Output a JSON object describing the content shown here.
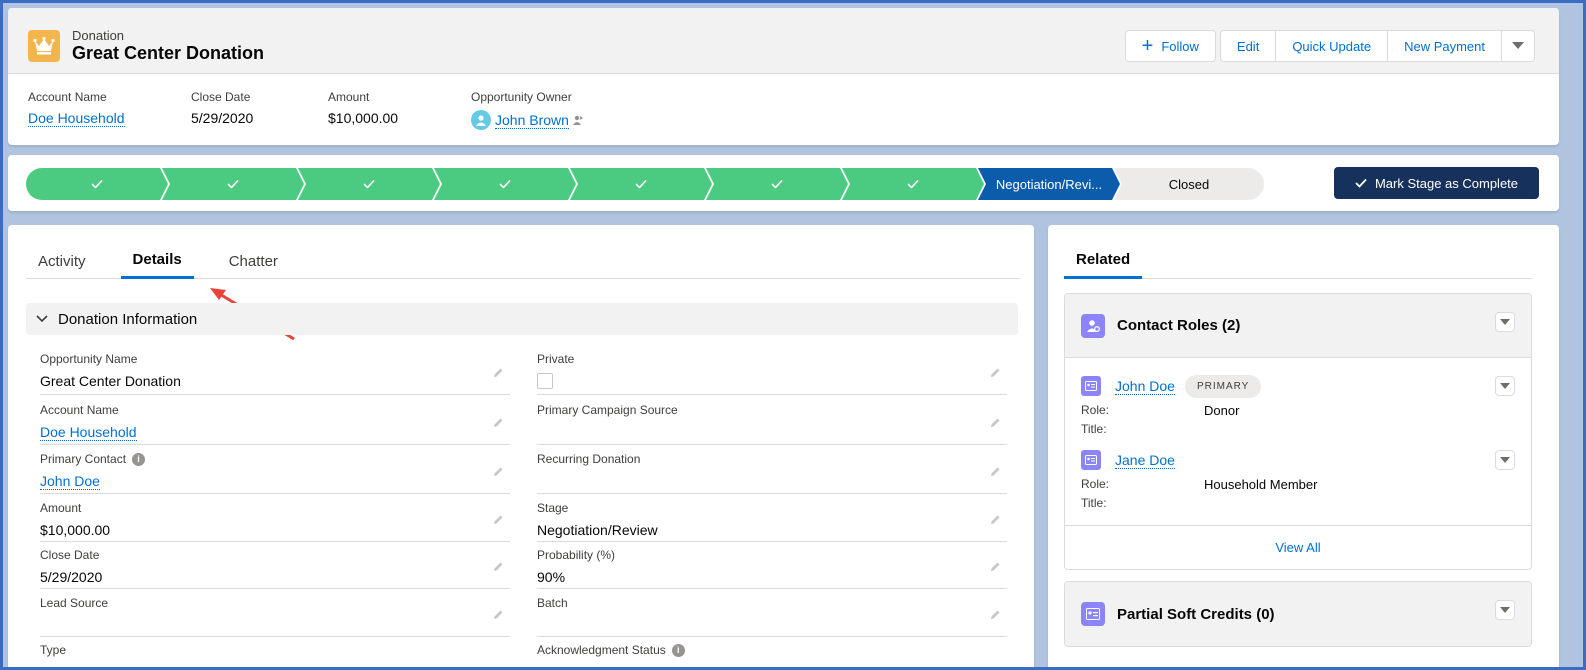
{
  "header": {
    "object_type": "Donation",
    "record_title": "Great Center Donation",
    "buttons": {
      "follow": "Follow",
      "edit": "Edit",
      "quick_update": "Quick Update",
      "new_payment": "New Payment"
    },
    "highlights": [
      {
        "label": "Account Name",
        "value": "Doe Household"
      },
      {
        "label": "Close Date",
        "value": "5/29/2020"
      },
      {
        "label": "Amount",
        "value": "$10,000.00"
      },
      {
        "label": "Opportunity Owner",
        "value": "John Brown"
      }
    ]
  },
  "path": {
    "completed_count": 7,
    "current": "Negotiation/Revi...",
    "next": "Closed",
    "mark_button": "Mark Stage as Complete"
  },
  "tabs": [
    "Activity",
    "Details",
    "Chatter"
  ],
  "active_tab": "Details",
  "section": {
    "title": "Donation Information",
    "left_fields": [
      {
        "label": "Opportunity Name",
        "value": "Great Center Donation"
      },
      {
        "label": "Account Name",
        "value": "Doe Household"
      },
      {
        "label": "Primary Contact",
        "value": "John Doe"
      },
      {
        "label": "Amount",
        "value": "$10,000.00"
      },
      {
        "label": "Close Date",
        "value": "5/29/2020"
      },
      {
        "label": "Lead Source",
        "value": ""
      },
      {
        "label": "Type",
        "value": ""
      }
    ],
    "right_fields": [
      {
        "label": "Private",
        "value": ""
      },
      {
        "label": "Primary Campaign Source",
        "value": ""
      },
      {
        "label": "Recurring Donation",
        "value": ""
      },
      {
        "label": "Stage",
        "value": "Negotiation/Review"
      },
      {
        "label": "Probability (%)",
        "value": "90%"
      },
      {
        "label": "Batch",
        "value": ""
      },
      {
        "label": "Acknowledgment Status",
        "value": ""
      }
    ]
  },
  "related": {
    "tab": "Related",
    "contact_roles": {
      "title": "Contact Roles (2)",
      "items": [
        {
          "name": "John Doe",
          "badge": "PRIMARY",
          "role_label": "Role:",
          "role": "Donor",
          "title_label": "Title:",
          "title": ""
        },
        {
          "name": "Jane Doe",
          "badge": "",
          "role_label": "Role:",
          "role": "Household Member",
          "title_label": "Title:",
          "title": ""
        }
      ],
      "view_all": "View All"
    },
    "partial_soft_credits": {
      "title": "Partial Soft Credits (0)"
    }
  },
  "colors": {
    "brand_blue": "#0070d2",
    "path_complete": "#4bca81",
    "path_current": "#0b5cab",
    "mark_button": "#16325c",
    "donation_icon": "#f4b64c",
    "contact_icon": "#8b85f9",
    "annotation_arrow": "#e8423b"
  },
  "icons": [
    "crown-icon",
    "plus-icon",
    "chevron-down-icon",
    "check-icon",
    "pencil-icon",
    "info-icon",
    "contact-role-icon",
    "contact-card-icon",
    "user-avatar-icon",
    "change-owner-icon",
    "red-annotation-arrow"
  ]
}
